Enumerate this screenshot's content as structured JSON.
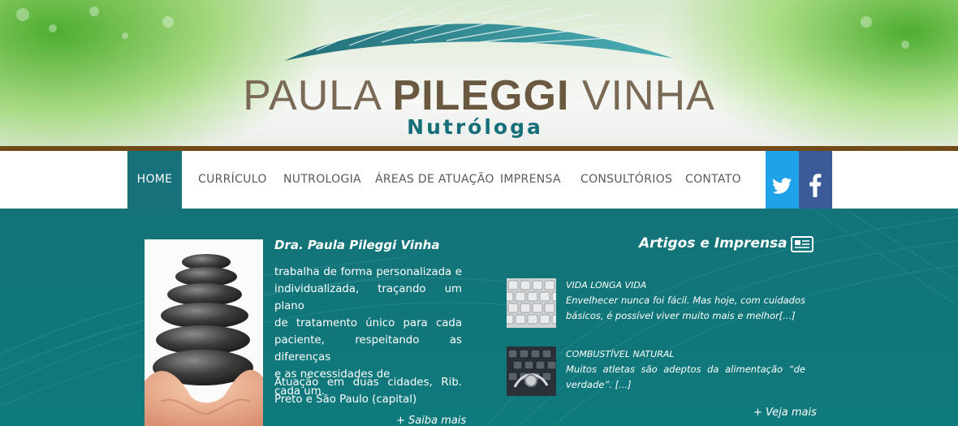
{
  "header": {
    "logo_first": "PAULA",
    "logo_bold": "PILEGGI",
    "logo_last": "VINHA",
    "subtitle": "Nutróloga"
  },
  "nav": {
    "items": [
      {
        "label": "HOME",
        "active": true
      },
      {
        "label": "CURRÍCULO"
      },
      {
        "label": "NUTROLOGIA"
      },
      {
        "label": "ÁREAS DE ATUAÇÃO"
      },
      {
        "label": "IMPRENSA"
      },
      {
        "label": "CONSULTÓRIOS"
      },
      {
        "label": "CONTATO"
      }
    ],
    "social": [
      {
        "icon": "twitter-icon",
        "color": "#1ea2e8"
      },
      {
        "icon": "facebook-icon",
        "color": "#3b5b98"
      }
    ]
  },
  "about": {
    "title": "Dra. Paula Pileggi Vinha",
    "lines_p1": [
      "trabalha de forma personalizada e",
      "individualizada, traçando um plano",
      "de tratamento único para cada",
      "paciente, respeitando as diferenças",
      "e as necessidades de",
      "cada um."
    ],
    "lines_p2": [
      "Atuação em duas cidades, Rib.",
      "Preto e São Paulo (capital)"
    ],
    "more_link": "+ Saiba mais"
  },
  "articles": {
    "title": "Artigos e Imprensa",
    "items": [
      {
        "headline": "VIDA LONGA VIDA",
        "lines": [
          "Envelhecer nunca foi fácil. Mas hoje, com cuidados",
          "básicos, é possível viver muito mais e melhor[...]"
        ]
      },
      {
        "headline": "COMBUSTÍVEL NATURAL",
        "lines": [
          "Muitos atletas são adeptos da alimentação “de",
          "verdade”. [...]"
        ]
      }
    ],
    "more_link": "+ Veja mais"
  },
  "colors": {
    "brand_teal": "#17717a",
    "brown_bar": "#704b18",
    "twitter": "#1ea2e8",
    "facebook": "#3b5b98"
  }
}
